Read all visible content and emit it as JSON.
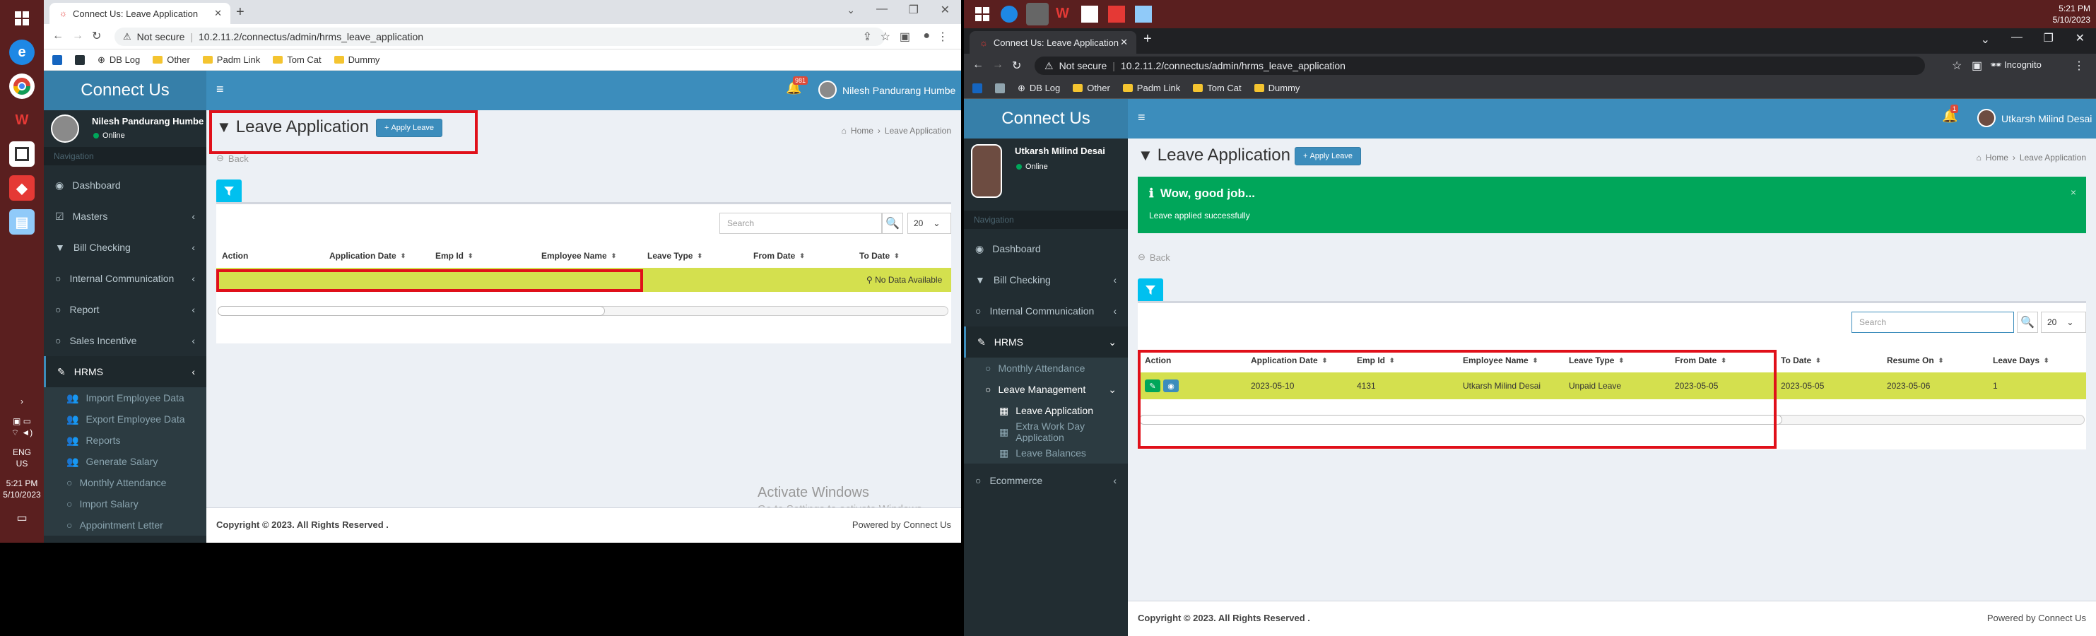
{
  "left": {
    "taskbar": {
      "time": "5:21 PM",
      "date": "5/10/2023",
      "lang1": "ENG",
      "lang2": "US"
    },
    "browser": {
      "tab_title": "Connect Us: Leave Application",
      "security": "Not secure",
      "url": "10.2.11.2/connectus/admin/hrms_leave_application",
      "bookmarks": [
        "DB Log",
        "Other",
        "Padm Link",
        "Tom Cat",
        "Dummy"
      ]
    },
    "app": {
      "brand": "Connect Us",
      "notif_count": "981",
      "header_user": "Nilesh Pandurang Humbe",
      "sidebar_user": "Nilesh Pandurang Humbe",
      "status": "Online",
      "nav_header": "Navigation",
      "nav": [
        "Dashboard",
        "Masters",
        "Bill Checking",
        "Internal Communication",
        "Report",
        "Sales Incentive",
        "HRMS"
      ],
      "subnav": [
        "Import Employee Data",
        "Export Employee Data",
        "Reports",
        "Generate Salary",
        "Monthly Attendance",
        "Import Salary",
        "Appointment Letter"
      ],
      "page_title": "Leave Application",
      "apply_label": "Apply Leave",
      "breadcrumb_home": "Home",
      "breadcrumb_current": "Leave Application",
      "back": "Back",
      "search_placeholder": "Search",
      "page_size": "20",
      "columns": [
        "Action",
        "Application Date",
        "Emp Id",
        "Employee Name",
        "Leave Type",
        "From Date",
        "To Date"
      ],
      "no_data": "No Data Available",
      "footer_copy": "Copyright © 2023. All Rights Reserved .",
      "footer_powered": "Powered by Connect Us",
      "watermark_title": "Activate Windows",
      "watermark_sub": "Go to Settings to activate Windows."
    }
  },
  "right": {
    "taskbar": {
      "time": "5:21 PM",
      "date": "5/10/2023"
    },
    "browser": {
      "tab_title": "Connect Us: Leave Application",
      "security": "Not secure",
      "url": "10.2.11.2/connectus/admin/hrms_leave_application",
      "mode": "Incognito",
      "bookmarks": [
        "DB Log",
        "Other",
        "Padm Link",
        "Tom Cat",
        "Dummy"
      ]
    },
    "app": {
      "brand": "Connect Us",
      "notif_count": "1",
      "header_user": "Utkarsh Milind Desai",
      "sidebar_user": "Utkarsh Milind Desai",
      "status": "Online",
      "nav_header": "Navigation",
      "nav": [
        "Dashboard",
        "Bill Checking",
        "Internal Communication",
        "HRMS"
      ],
      "subnav": [
        "Monthly Attendance",
        "Leave Management",
        "Leave Application",
        "Extra Work Day Application",
        "Leave Balances"
      ],
      "nav_bottom": "Ecommerce",
      "page_title": "Leave Application",
      "apply_label": "Apply Leave",
      "breadcrumb_home": "Home",
      "breadcrumb_current": "Leave Application",
      "alert_title": "Wow, good job...",
      "alert_msg": "Leave applied successfully",
      "back": "Back",
      "search_placeholder": "Search",
      "page_size": "20",
      "columns": [
        "Action",
        "Application Date",
        "Emp Id",
        "Employee Name",
        "Leave Type",
        "From Date",
        "To Date",
        "Resume On",
        "Leave Days"
      ],
      "row": [
        "2023-05-10",
        "4131",
        "Utkarsh Milind Desai",
        "Unpaid Leave",
        "2023-05-05",
        "2023-05-05",
        "2023-05-06",
        "1"
      ],
      "footer_copy": "Copyright © 2023. All Rights Reserved .",
      "footer_powered": "Powered by Connect Us"
    }
  },
  "colors": {
    "header": "#3c8dbc",
    "sidebar": "#222d32",
    "highlight_row": "#d4e04e",
    "annotation_red": "#e0101a",
    "success": "#00a65a"
  }
}
